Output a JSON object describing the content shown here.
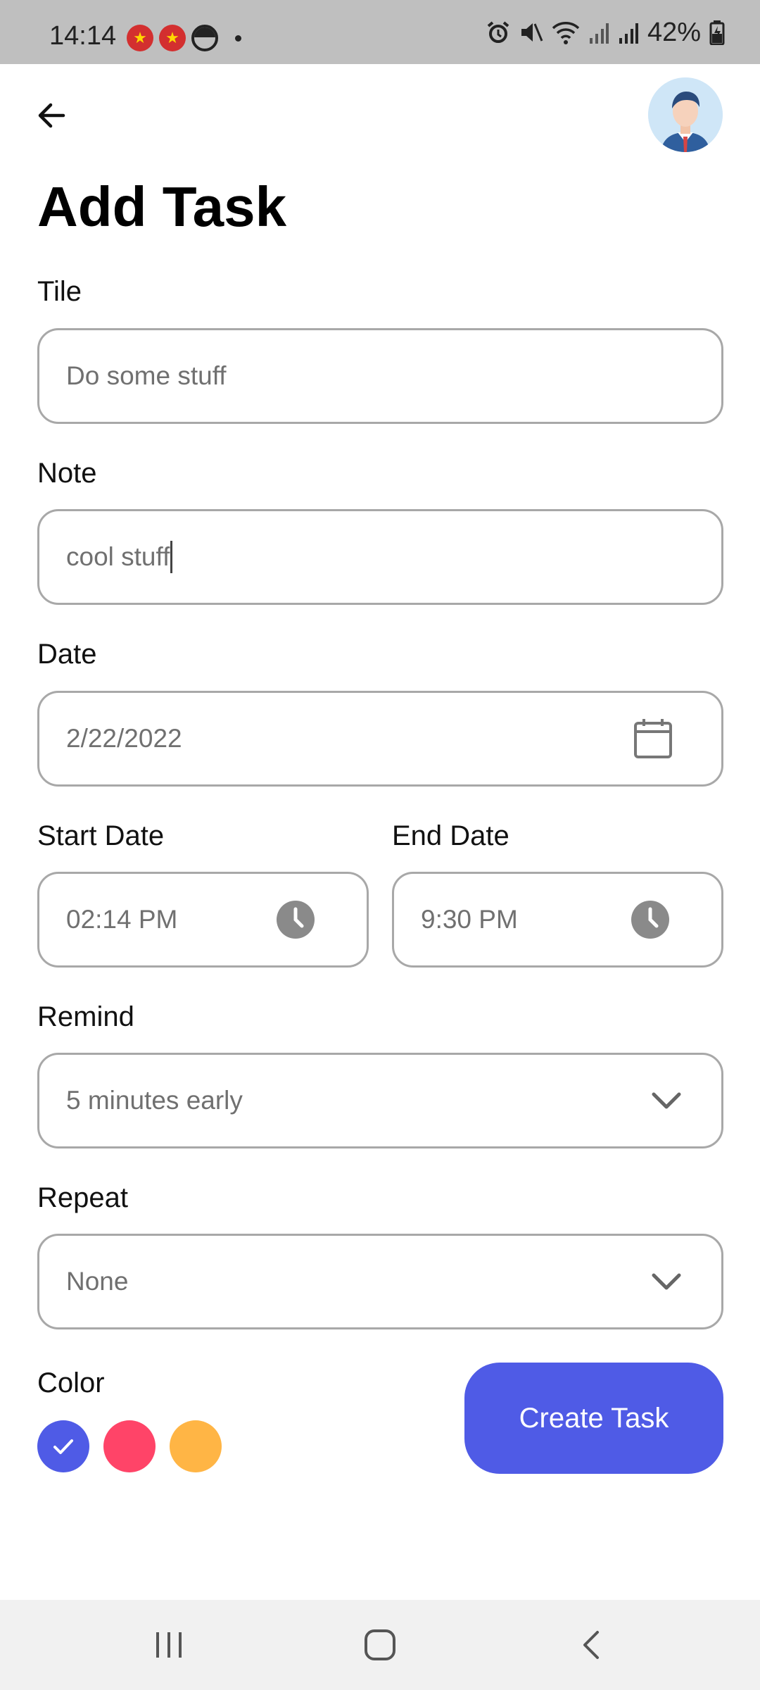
{
  "status_bar": {
    "time": "14:14",
    "battery": "42%"
  },
  "header": {
    "title": "Add Task"
  },
  "form": {
    "title_label": "Tile",
    "title_value": "Do some stuff",
    "note_label": "Note",
    "note_value": "cool stuff",
    "date_label": "Date",
    "date_value": "2/22/2022",
    "start_label": "Start Date",
    "start_value": "02:14 PM",
    "end_label": "End Date",
    "end_value": "9:30 PM",
    "remind_label": "Remind",
    "remind_value": "5 minutes early",
    "repeat_label": "Repeat",
    "repeat_value": "None",
    "color_label": "Color",
    "colors": [
      "#4f5be6",
      "#ff4468",
      "#ffb545"
    ],
    "selected_color_index": 0
  },
  "actions": {
    "create_label": "Create Task"
  },
  "colors": {
    "accent": "#4f5be6",
    "field_border": "#a8a8a8",
    "placeholder_text": "#707070"
  }
}
